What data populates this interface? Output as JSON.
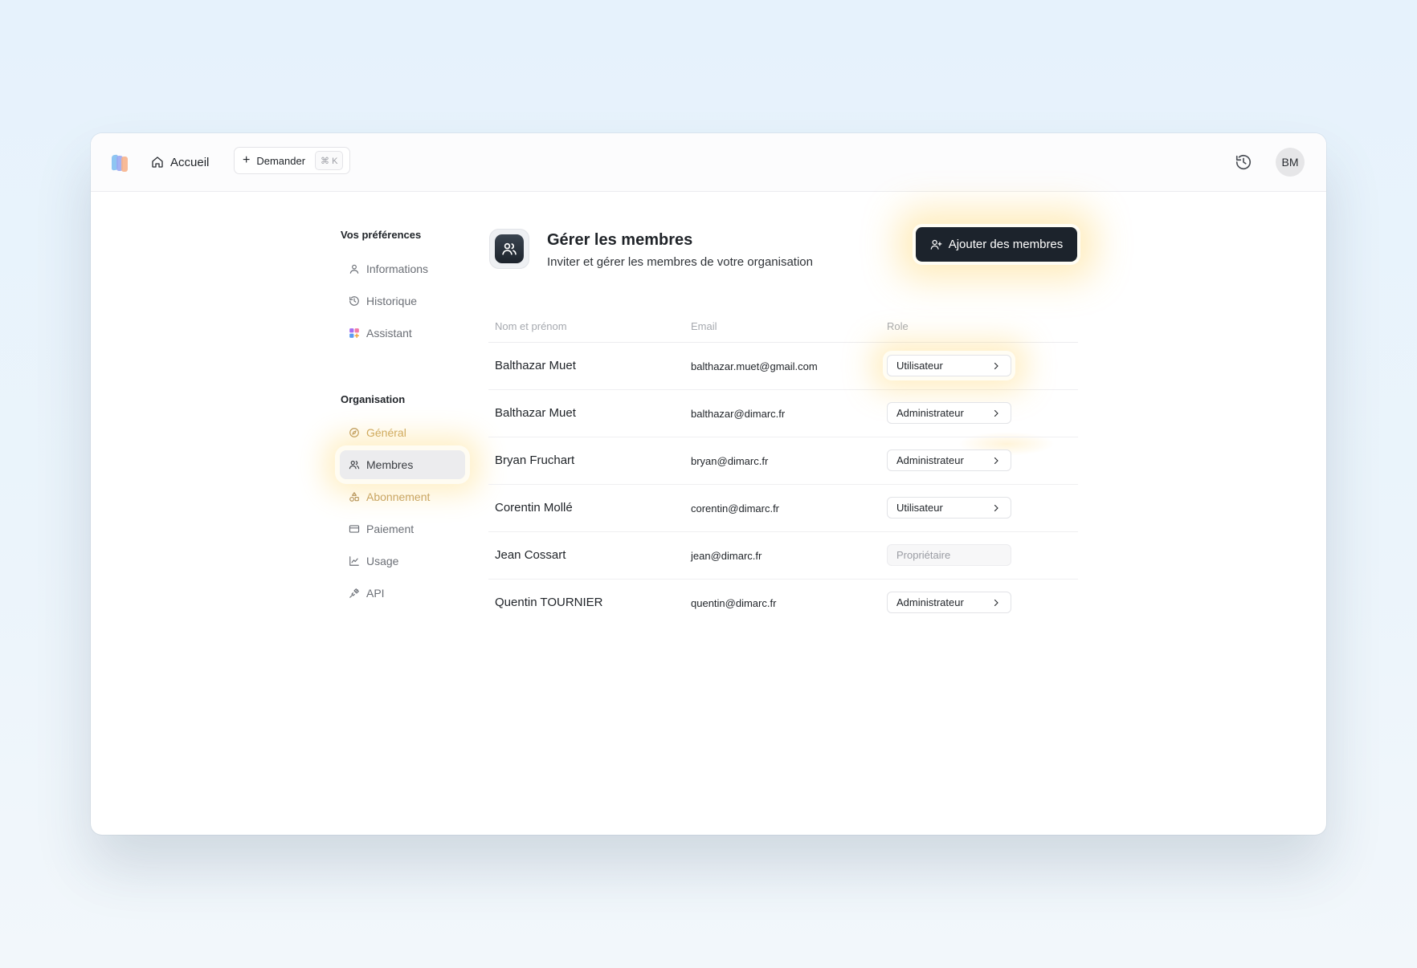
{
  "topbar": {
    "home_label": "Accueil",
    "ask_label": "Demander",
    "ask_shortcut": "⌘ K",
    "avatar_initials": "BM"
  },
  "sidebar": {
    "preferences_title": "Vos préférences",
    "preferences_items": [
      {
        "label": "Informations",
        "icon": "user-icon"
      },
      {
        "label": "Historique",
        "icon": "history-icon"
      },
      {
        "label": "Assistant",
        "icon": "apps-icon"
      }
    ],
    "organisation_title": "Organisation",
    "organisation_items": [
      {
        "label": "Général",
        "icon": "compass-icon"
      },
      {
        "label": "Membres",
        "icon": "users-icon",
        "active": true
      },
      {
        "label": "Abonnement",
        "icon": "shapes-icon"
      },
      {
        "label": "Paiement",
        "icon": "credit-card-icon"
      },
      {
        "label": "Usage",
        "icon": "line-chart-icon"
      },
      {
        "label": "API",
        "icon": "plug-icon"
      }
    ]
  },
  "header": {
    "title": "Gérer les membres",
    "subtitle": "Inviter et gérer les membres de votre organisation",
    "add_button_label": "Ajouter des membres"
  },
  "table": {
    "columns": [
      "Nom et prénom",
      "Email",
      "Role"
    ],
    "rows": [
      {
        "name": "Balthazar Muet",
        "email": "balthazar.muet@gmail.com",
        "role": "Utilisateur",
        "editable": true
      },
      {
        "name": "Balthazar Muet",
        "email": "balthazar@dimarc.fr",
        "role": "Administrateur",
        "editable": true
      },
      {
        "name": "Bryan Fruchart",
        "email": "bryan@dimarc.fr",
        "role": "Administrateur",
        "editable": true
      },
      {
        "name": "Corentin Mollé",
        "email": "corentin@dimarc.fr",
        "role": "Utilisateur",
        "editable": true
      },
      {
        "name": "Jean Cossart",
        "email": "jean@dimarc.fr",
        "role": "Propriétaire",
        "editable": false
      },
      {
        "name": "Quentin TOURNIER",
        "email": "quentin@dimarc.fr",
        "role": "Administrateur",
        "editable": true
      }
    ]
  },
  "colors": {
    "primary_dark": "#1c232c",
    "highlight_glow": "#ffcd50",
    "active_item_bg": "#ececee"
  }
}
